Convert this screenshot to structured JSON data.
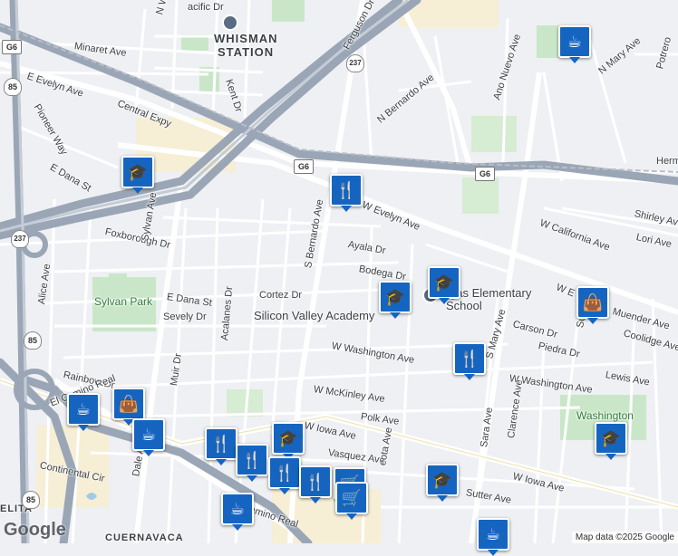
{
  "labels": {
    "whisman_station": "WHISMAN\nSTATION",
    "whisman_station_l1": "WHISMAN",
    "whisman_station_l2": "STATION",
    "n_whisman": "N Whis",
    "pacific_dr": "acific Dr",
    "kent_dr": "Kent Dr",
    "ferguson_dr": "Ferguson Dr",
    "minaret_ave": "Minaret Ave",
    "e_evelyn_ave": "E Evelyn Ave",
    "central_expy": "Central Expy",
    "pioneer_way": "Pioneer Way",
    "e_dana": "E Dana St",
    "n_bernardo_ave": "N Bernardo Ave",
    "ano_nuevo_ave": "Ano Nuevo Ave",
    "n_mary_ave": "N Mary Ave",
    "potrero": "Potrero",
    "herm": "Herm",
    "w_evelyn_ave": "W Evelyn Ave",
    "s_bernardo_ave": "S Bernardo Ave",
    "ayala_dr": "Ayala Dr",
    "bodega_dr": "Bodega Dr",
    "w_california_ave": "W California Ave",
    "shirley_ave": "Shirley Ave",
    "lori_ave": "Lori Ave",
    "w_e_prefix": "W E",
    "foxborough_dr": "Foxborough Dr",
    "sylvan_ave": "Sylvan Ave",
    "sylvan_park": "Sylvan Park",
    "alice_ave": "Alice Ave",
    "e_dana_st": "E Dana St",
    "sevely_dr": "Sevely Dr",
    "cortez_dr": "Cortez Dr",
    "silicon_valley_academy": "Silicon Valley Academy",
    "vargas_school": "gas Elementary\nSchool",
    "vargas_school_l1": "gas Elementary",
    "vargas_school_l2": "School",
    "acalanes_dr": "Acalanes Dr",
    "w_washington_ave": "W Washington Ave",
    "carson_dr": "Carson Dr",
    "piedra_dr": "Piedra Dr",
    "muender_ave": "Muender Ave",
    "coolidge_ave": "Coolidge Ave",
    "lewis_ave": "Lewis Ave",
    "w_washington_ave_2": "W Washington Ave",
    "s_mary_ave": "S Mary Ave",
    "sunset": "Sunset",
    "rainbow_dr": "Rainbow Dr",
    "muir_dr": "Muir Dr",
    "w_mckinley_ave": "W McKinley Ave",
    "polk_ave": "Polk Ave",
    "washington": "Washington",
    "el_camino_real": "El Camino Real",
    "w_iowa_ave": "W Iowa Ave",
    "w_iowa_ave_2": "W Iowa Ave",
    "vasquez_ave": "Vasquez Ave",
    "continental_cir": "Continental Cir",
    "dale_ave": "Dale Ave",
    "sara_ave": "Sara Ave",
    "clarence_ave": "Clarence Ave",
    "sutter_ave": "Sutter Ave",
    "leota_ave": "eota Ave",
    "camino_real_2": "Camino Real",
    "cuernavaca": "CUERNAVACA",
    "elita": "ELITA"
  },
  "shields": {
    "g6_a": "G6",
    "g6_b": "G6",
    "g6_c": "G6",
    "r237_a": "237",
    "r237_b": "237",
    "r85_a": "85",
    "r85_b": "85",
    "r85_c": "85"
  },
  "pins": [
    {
      "icon": "coffee-icon",
      "glyph": "☕"
    },
    {
      "icon": "school-icon",
      "glyph": "🎓"
    },
    {
      "icon": "restaurant-icon",
      "glyph": "🍴"
    },
    {
      "icon": "school-icon",
      "glyph": "🎓"
    },
    {
      "icon": "school-icon",
      "glyph": "🎓"
    },
    {
      "icon": "shopping-bag-icon",
      "glyph": "👜"
    },
    {
      "icon": "restaurant-icon",
      "glyph": "🍴"
    },
    {
      "icon": "coffee-icon",
      "glyph": "☕"
    },
    {
      "icon": "shopping-bag-icon",
      "glyph": "👜"
    },
    {
      "icon": "coffee-icon",
      "glyph": "☕"
    },
    {
      "icon": "restaurant-icon",
      "glyph": "🍴"
    },
    {
      "icon": "school-icon",
      "glyph": "🎓"
    },
    {
      "icon": "restaurant-icon",
      "glyph": "🍴"
    },
    {
      "icon": "shopping-cart-icon",
      "glyph": "🛒"
    },
    {
      "icon": "school-icon",
      "glyph": "🎓"
    },
    {
      "icon": "coffee-icon",
      "glyph": "☕"
    },
    {
      "icon": "school-icon",
      "glyph": "🎓"
    },
    {
      "icon": "coffee-icon",
      "glyph": "☕"
    }
  ],
  "logo": "Google",
  "attribution": "Map data ©2025 Google",
  "colors": {
    "pin": "#1565c0",
    "highway": "#9aa6b6",
    "road": "#ffffff",
    "park": "#c9e7c8",
    "commercial": "#f6eed5",
    "background": "#eef0f3"
  }
}
